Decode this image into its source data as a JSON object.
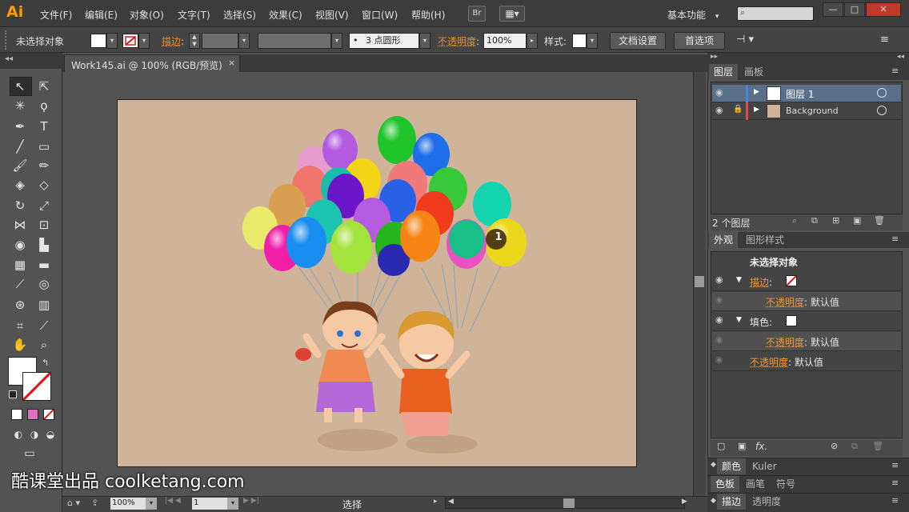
{
  "app": {
    "logo": "Ai"
  },
  "menu": [
    "文件(F)",
    "编辑(E)",
    "对象(O)",
    "文字(T)",
    "选择(S)",
    "效果(C)",
    "视图(V)",
    "窗口(W)",
    "帮助(H)"
  ],
  "menubar": {
    "bridge_label": "Br",
    "workspace": "基本功能",
    "workspace_arrow": "▾"
  },
  "window_controls": {
    "minimize": "—",
    "maximize": "□",
    "close": "✕"
  },
  "control_bar": {
    "selection": "未选择对象",
    "stroke_label": "描边",
    "stroke_colon": ":",
    "brush_dot": "•",
    "brush_size": "3 点圆形",
    "opacity_label": "不透明度",
    "opacity_colon": ":",
    "opacity_value": "100%",
    "style_label": "样式:",
    "doc_setup": "文档设置",
    "preferences": "首选项"
  },
  "document_tab": {
    "title": "Work145.ai @ 100% (RGB/预览)",
    "close": "×"
  },
  "layers_panel": {
    "tabs": [
      "图层",
      "画板"
    ],
    "layers": [
      {
        "name": "图层 1",
        "color": "#4f81d8",
        "selected": true,
        "locked": false
      },
      {
        "name": "Background",
        "color": "#e04a4a",
        "selected": false,
        "locked": true
      }
    ],
    "footer": "2 个图层"
  },
  "appearance_panel": {
    "tabs": [
      "外观",
      "图形样式"
    ],
    "header": "未选择对象",
    "rows": [
      {
        "label": "描边",
        "suffix": ":",
        "type": "stroke"
      },
      {
        "label": "不透明度",
        "suffix": ":",
        "value": "默认值",
        "indent": true
      },
      {
        "label": "填色",
        "suffix": ":",
        "type": "fill"
      },
      {
        "label": "不透明度",
        "suffix": ":",
        "value": "默认值",
        "indent": true
      },
      {
        "label": "不透明度",
        "suffix": ":",
        "value": "默认值",
        "indent": false
      }
    ],
    "fx": "fx."
  },
  "collapsed_panels": [
    {
      "tabs": [
        "颜色",
        "Kuler"
      ]
    },
    {
      "tabs": [
        "色板",
        "画笔",
        "符号"
      ]
    },
    {
      "tabs": [
        "描边",
        "透明度"
      ]
    }
  ],
  "status_bar": {
    "zoom": "100%",
    "page": "1",
    "tool": "选择"
  },
  "callout": {
    "number": "1"
  },
  "watermark": "酷课堂出品 coolketang.com",
  "colors": {
    "accent_orange": "#ff9a00",
    "panel_bg": "#535353",
    "artboard": "#d0b49a"
  }
}
